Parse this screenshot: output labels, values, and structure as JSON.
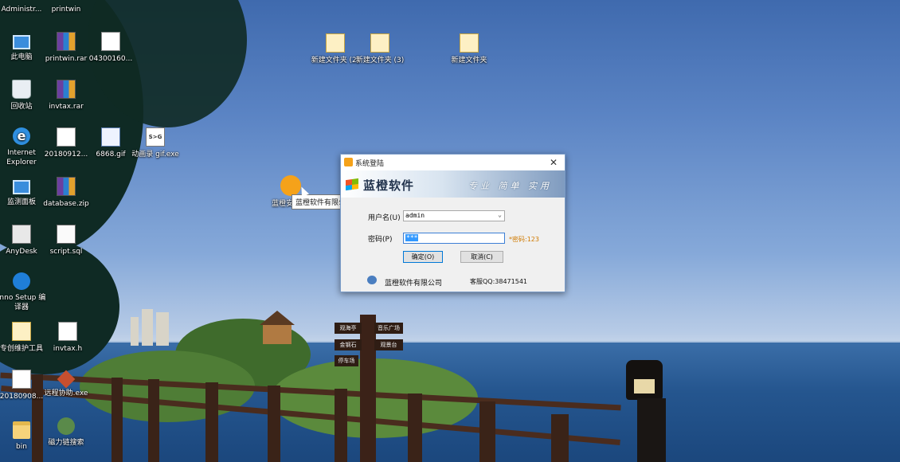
{
  "desktop_icons": [
    {
      "label": "Administr..."
    },
    {
      "label": "printwin"
    },
    {
      "label": "此电脑"
    },
    {
      "label": "printwin.rar"
    },
    {
      "label": "04300160..."
    },
    {
      "label": "回收站"
    },
    {
      "label": "invtax.rar"
    },
    {
      "label": "Internet Explorer"
    },
    {
      "label": "20180912..."
    },
    {
      "label": "6868.gif"
    },
    {
      "label": "动画录 gif.exe"
    },
    {
      "label": "监测面板"
    },
    {
      "label": "database.zip"
    },
    {
      "label": "AnyDesk"
    },
    {
      "label": "script.sql"
    },
    {
      "label": "Inno Setup 编译器"
    },
    {
      "label": "专创维护工具"
    },
    {
      "label": "invtax.h"
    },
    {
      "label": "20180908..."
    },
    {
      "label": "远程协助.exe"
    },
    {
      "label": "bin"
    },
    {
      "label": "磁力链搜索"
    },
    {
      "label": "新建文件夹 (2)"
    },
    {
      "label": "新建文件夹 (3)"
    },
    {
      "label": "新建文件夹"
    },
    {
      "label": "蓝橙安 装版"
    }
  ],
  "tooltip": "蓝橙软件有限公司",
  "signs": [
    "观海亭",
    "音乐广场",
    "金钢石",
    "观景台",
    "停车场"
  ],
  "dialog": {
    "title": "系统登陆",
    "close": "✕",
    "brand": "蓝橙软件",
    "slogan": "专业 简单 实用",
    "username_label": "用户名(U)",
    "username_value": "admin",
    "password_label": "密码(P)",
    "password_value": "***",
    "password_hint": "*密码:123",
    "ok_button": "确定(O)",
    "cancel_button": "取消(C)",
    "company": "蓝橙软件有限公司",
    "support": "客服QQ:38471541"
  }
}
